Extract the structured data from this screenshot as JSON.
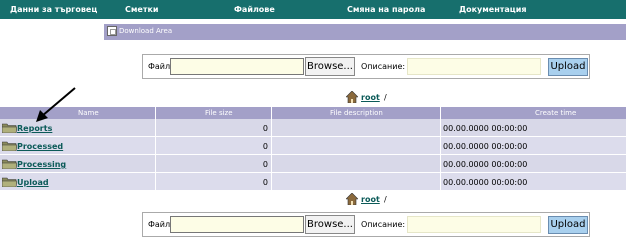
{
  "nav": {
    "items": [
      {
        "label": "Данни за търговец"
      },
      {
        "label": "Сметки"
      },
      {
        "label": "Файлове"
      },
      {
        "label": "Смяна на парола"
      },
      {
        "label": "Документация"
      }
    ]
  },
  "subbar": {
    "label": "Download Area"
  },
  "upload": {
    "file_label": "Файл:",
    "browse_label": "Browse...",
    "desc_label": "Описание:",
    "upload_label": "Upload"
  },
  "breadcrumb": {
    "root": "root",
    "sep": "/"
  },
  "table": {
    "headers": {
      "name": "Name",
      "size": "File size",
      "desc": "File description",
      "time": "Create time"
    },
    "rows": [
      {
        "name": "Reports",
        "size": "0",
        "time": "00.00.0000 00:00:00"
      },
      {
        "name": "Processed",
        "size": "0",
        "time": "00.00.0000 00:00:00"
      },
      {
        "name": "Processing",
        "size": "0",
        "time": "00.00.0000 00:00:00"
      },
      {
        "name": "Upload",
        "size": "0",
        "time": "00.00.0000 00:00:00"
      }
    ]
  },
  "colors": {
    "nav": "#176f6d",
    "header": "#a3a0c8",
    "row": "#d8d8e8",
    "link": "#0b5a58",
    "upload_button": "#a9d0ee",
    "input_bg": "#fdfde6"
  },
  "icons": [
    "download-area-icon",
    "home-icon",
    "folder-icon",
    "arrow-annotation"
  ]
}
